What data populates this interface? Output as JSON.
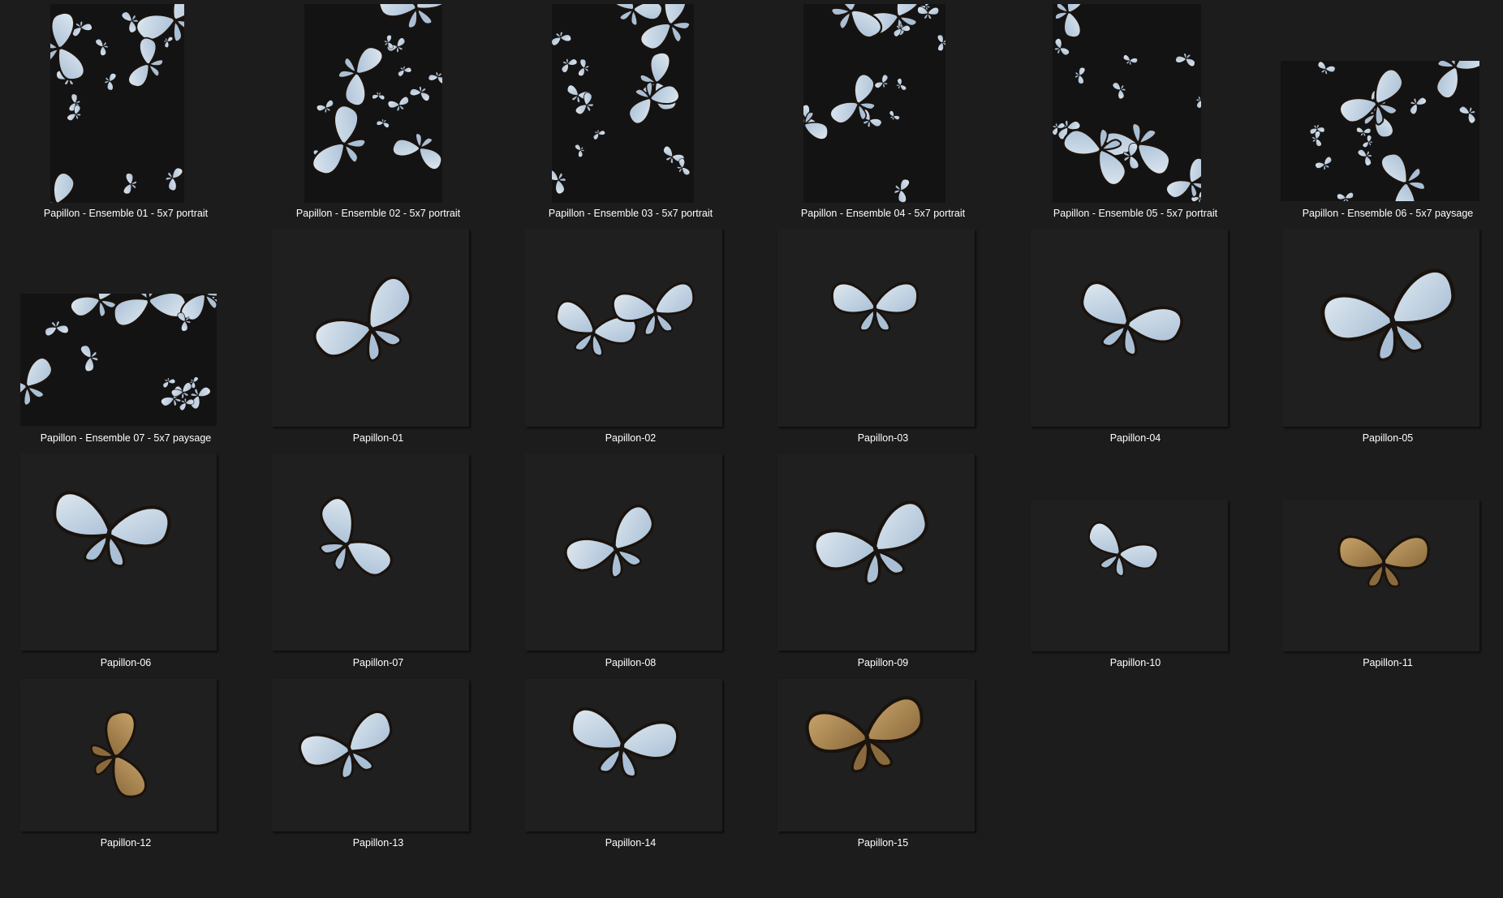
{
  "folder": {
    "items": [
      {
        "label": "Papillon - Ensemble 01 - 5x7 portrait",
        "kind": "portrait",
        "icon": "butterfly-set-thumbnail"
      },
      {
        "label": "Papillon - Ensemble 02 - 5x7 portrait",
        "kind": "portrait",
        "icon": "butterfly-set-thumbnail"
      },
      {
        "label": "Papillon - Ensemble 03 - 5x7 portrait",
        "kind": "portrait",
        "icon": "butterfly-set-thumbnail"
      },
      {
        "label": "Papillon - Ensemble 04 - 5x7 portrait",
        "kind": "portrait",
        "icon": "butterfly-set-thumbnail"
      },
      {
        "label": "Papillon - Ensemble 05 - 5x7 portrait",
        "kind": "portrait",
        "icon": "butterfly-set-thumbnail"
      },
      {
        "label": "Papillon - Ensemble 06 - 5x7 paysage",
        "kind": "landscape",
        "icon": "butterfly-set-thumbnail"
      },
      {
        "label": "Papillon - Ensemble 07 - 5x7 paysage",
        "kind": "landscape",
        "icon": "butterfly-set-thumbnail"
      },
      {
        "label": "Papillon-01",
        "kind": "square",
        "icon": "butterfly-thumbnail"
      },
      {
        "label": "Papillon-02",
        "kind": "square",
        "icon": "butterfly-thumbnail"
      },
      {
        "label": "Papillon-03",
        "kind": "square",
        "icon": "butterfly-thumbnail"
      },
      {
        "label": "Papillon-04",
        "kind": "square",
        "icon": "butterfly-thumbnail"
      },
      {
        "label": "Papillon-05",
        "kind": "square",
        "icon": "butterfly-thumbnail"
      },
      {
        "label": "Papillon-06",
        "kind": "square",
        "icon": "butterfly-thumbnail"
      },
      {
        "label": "Papillon-07",
        "kind": "square",
        "icon": "butterfly-thumbnail"
      },
      {
        "label": "Papillon-08",
        "kind": "square",
        "icon": "butterfly-thumbnail"
      },
      {
        "label": "Papillon-09",
        "kind": "square",
        "icon": "butterfly-thumbnail"
      },
      {
        "label": "Papillon-10",
        "kind": "square",
        "icon": "butterfly-thumbnail"
      },
      {
        "label": "Papillon-11",
        "kind": "square",
        "icon": "butterfly-thumbnail"
      },
      {
        "label": "Papillon-12",
        "kind": "square",
        "icon": "butterfly-thumbnail"
      },
      {
        "label": "Papillon-13",
        "kind": "square",
        "icon": "butterfly-thumbnail"
      },
      {
        "label": "Papillon-14",
        "kind": "square",
        "icon": "butterfly-thumbnail"
      },
      {
        "label": "Papillon-15",
        "kind": "square",
        "icon": "butterfly-thumbnail"
      }
    ]
  },
  "colors": {
    "background": "#1c1c1c",
    "thumb_bg": "#1f1f1f",
    "label_text": "#ffffff",
    "wing_light": "#dfe9f0",
    "wing_blue": "#a9bfd6",
    "wing_edge": "#1a120c",
    "wing_brown": "#8a6a3c"
  }
}
